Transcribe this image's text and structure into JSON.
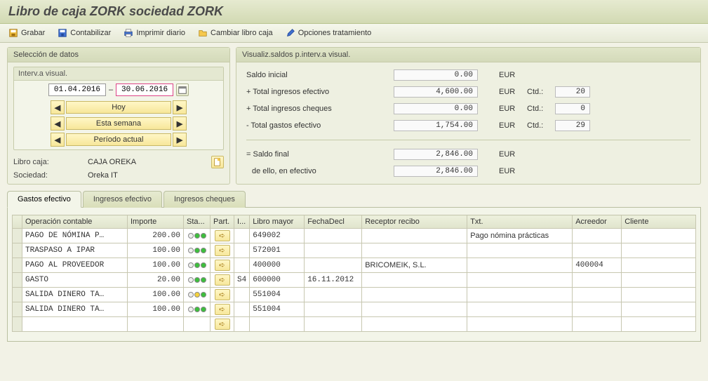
{
  "title": "Libro de caja ZORK  sociedad ZORK",
  "toolbar": {
    "save": "Grabar",
    "post": "Contabilizar",
    "print": "Imprimir diario",
    "change": "Cambiar libro caja",
    "options": "Opciones tratamiento"
  },
  "left": {
    "panel_title": "Selección de datos",
    "interval_title": "Interv.a visual.",
    "date_from": "01.04.2016",
    "date_sep": "–",
    "date_to": "30.06.2016",
    "nav": {
      "today": "Hoy",
      "week": "Esta semana",
      "period": "Período actual"
    },
    "libro_lbl": "Libro caja:",
    "libro_val": "CAJA OREKA",
    "soc_lbl": "Sociedad:",
    "soc_val": "Oreka IT"
  },
  "right": {
    "panel_title": "Visualiz.saldos p.interv.a visual.",
    "rows": {
      "saldo_inicial": "Saldo inicial",
      "ingresos_ef": "+ Total ingresos efectivo",
      "ingresos_ch": "+ Total ingresos cheques",
      "gastos_ef": "- Total gastos efectivo",
      "saldo_final": "= Saldo final",
      "de_ello": "  de ello, en efectivo"
    },
    "vals": {
      "saldo_inicial": "0.00",
      "ingresos_ef": "4,600.00",
      "ingresos_ch": "0.00",
      "gastos_ef": "1,754.00",
      "saldo_final": "2,846.00",
      "de_ello": "2,846.00"
    },
    "cur": "EUR",
    "ctd_lbl": "Ctd.:",
    "ctd": {
      "ingresos_ef": "20",
      "ingresos_ch": "0",
      "gastos_ef": "29"
    }
  },
  "tabs": {
    "gastos": "Gastos efectivo",
    "ing_ef": "Ingresos efectivo",
    "ing_ch": "Ingresos cheques"
  },
  "grid": {
    "headers": {
      "op": "Operación contable",
      "imp": "Importe",
      "sta": "Sta...",
      "part": "Part.",
      "i": "I...",
      "mayor": "Libro mayor",
      "fecha": "FechaDecl",
      "recep": "Receptor recibo",
      "txt": "Txt.",
      "acr": "Acreedor",
      "cli": "Cliente"
    },
    "rows": [
      {
        "op": "PAGO DE NÓMINA P…",
        "imp": "200.00",
        "sta": "gg",
        "i": "",
        "mayor": "649002",
        "fecha": "",
        "recep": "",
        "txt": "Pago nómina prácticas",
        "acr": "",
        "cli": ""
      },
      {
        "op": "TRASPASO A IPAR",
        "imp": "100.00",
        "sta": "gg",
        "i": "",
        "mayor": "572001",
        "fecha": "",
        "recep": "",
        "txt": "",
        "acr": "",
        "cli": ""
      },
      {
        "op": "PAGO AL PROVEEDOR",
        "imp": "100.00",
        "sta": "gg",
        "i": "",
        "mayor": "400000",
        "fecha": "",
        "recep": "BRICOMEIK, S.L.",
        "txt": "",
        "acr": "400004",
        "cli": ""
      },
      {
        "op": "GASTO",
        "imp": "20.00",
        "sta": "gg",
        "i": "S4",
        "mayor": "600000",
        "fecha": "16.11.2012",
        "recep": "",
        "txt": "",
        "acr": "",
        "cli": ""
      },
      {
        "op": "SALIDA DINERO TA…",
        "imp": "100.00",
        "sta": "yg",
        "i": "",
        "mayor": "551004",
        "fecha": "",
        "recep": "",
        "txt": "",
        "acr": "",
        "cli": ""
      },
      {
        "op": "SALIDA DINERO TA…",
        "imp": "100.00",
        "sta": "gg",
        "i": "",
        "mayor": "551004",
        "fecha": "",
        "recep": "",
        "txt": "",
        "acr": "",
        "cli": ""
      }
    ]
  }
}
